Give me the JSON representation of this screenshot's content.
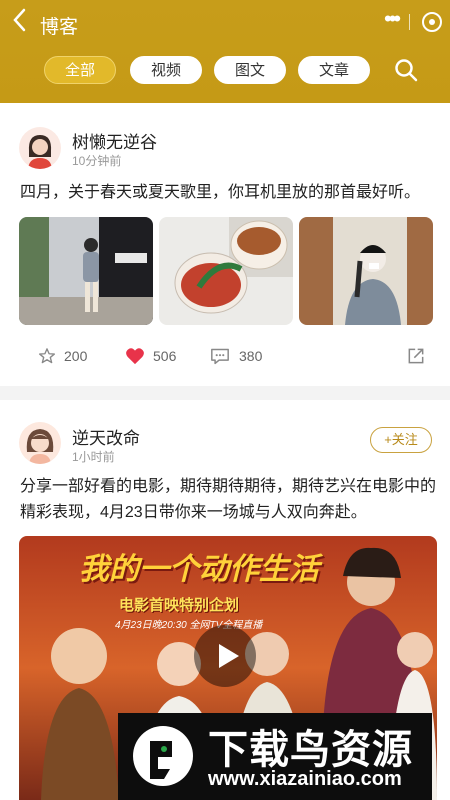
{
  "header": {
    "title": "博客",
    "tabs": [
      {
        "label": "全部",
        "active": true
      },
      {
        "label": "视频",
        "active": false
      },
      {
        "label": "图文",
        "active": false
      },
      {
        "label": "文章",
        "active": false
      }
    ],
    "accent_color": "#c79d1a"
  },
  "posts": [
    {
      "author": "树懒无逆谷",
      "time": "10分钟前",
      "text": "四月，关于春天或夏天歌里，你耳机里放的那首最好听。",
      "images": [
        "street-photo",
        "drink-photo",
        "cafe-photo"
      ],
      "stats": {
        "favorites": "200",
        "likes": "506",
        "comments": "380"
      },
      "liked": true
    },
    {
      "author": "逆天改命",
      "time": "1小时前",
      "follow_label": "+关注",
      "text": "分享一部好看的电影，期待期待期待，期待艺兴在电影中的精彩表现，4月23日带你来一场城与人双向奔赴。",
      "video": {
        "title_art": "我的一个动作生活",
        "subtitle": "电影首映特别企划",
        "date_line": "4月23日晚20:30 全网TV全程直播"
      }
    }
  ],
  "watermark": {
    "title": "下载鸟资源",
    "url": "www.xiazainiao.com"
  }
}
